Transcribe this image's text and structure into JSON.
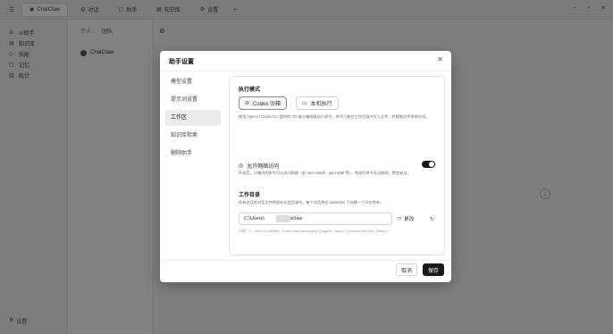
{
  "titlebar": {
    "tabs": [
      {
        "label": "ChatClaw"
      },
      {
        "label": "对话"
      },
      {
        "label": "助手"
      },
      {
        "label": "知识库"
      },
      {
        "label": "设置"
      }
    ]
  },
  "sidebar": {
    "items": [
      {
        "label": "AI助手"
      },
      {
        "label": "知识库"
      },
      {
        "label": "技能"
      },
      {
        "label": "记忆"
      },
      {
        "label": "统计"
      }
    ],
    "bottom_label": "设置"
  },
  "listpane": {
    "seg": [
      "个人",
      "团队"
    ],
    "assistant_name": "ChatClaw"
  },
  "modal": {
    "title": "助手设置",
    "nav": [
      {
        "label": "模型设置"
      },
      {
        "label": "提示词设置"
      },
      {
        "label": "工作区"
      },
      {
        "label": "知识库检索"
      },
      {
        "label": "删除助手"
      }
    ],
    "active_nav": "工作区",
    "exec_mode": {
      "title": "执行模式",
      "sandbox_label": "Codex 沙箱",
      "local_label": "本机执行",
      "selected": "sandbox",
      "desc": "使用 OpenAI Codex CLI 提供的 OS 级沙箱隔离执行命令。命令只能在工作目录内写入文件，并限制文件系统访问。"
    },
    "network": {
      "label": "允许网络访问",
      "enabled": true,
      "desc": "开启后，沙箱内的命令可以访问网络（如 npm install、pip install 等）。关闭后命令无法联网，更加安全。"
    },
    "workdir": {
      "title": "工作目录",
      "desc": "所有会话的对话文件将保存在此目录中。每个对话将在 sessions/ 下创建一个子文件夹。",
      "path_prefix": "C:\\Users\\",
      "path_suffix": "\\.chatclaw",
      "change_label": "更改",
      "example": "示例：C:\\Users\\10940\\.chatclaw\\sessions\\{agent_hash}\\{conversation_hash}\\"
    },
    "cancel_label": "取消",
    "save_label": "保存"
  }
}
